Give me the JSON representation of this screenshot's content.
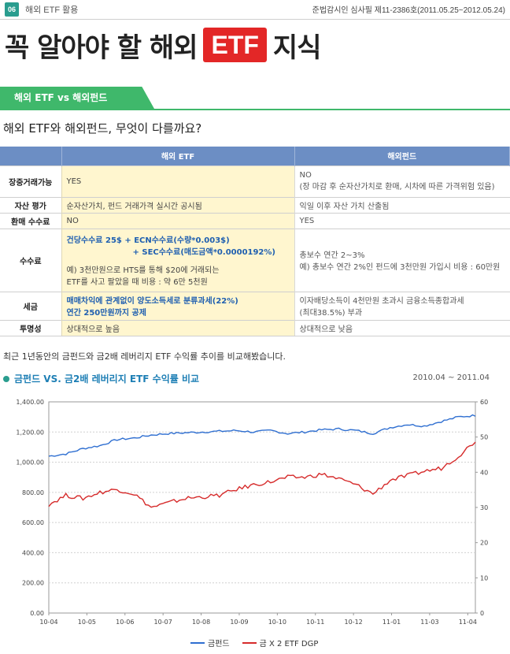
{
  "header": {
    "badge": "06",
    "section": "해외 ETF 활용",
    "review": "준법감시인 심사필 제11-2386호(2011.05.25~2012.05.24)"
  },
  "title": {
    "part1": "꼭 알아야 할 해외",
    "etf": "ETF",
    "part2": "지식"
  },
  "tab": {
    "label": "해외 ETF vs 해외펀드"
  },
  "question": "해외 ETF와 해외펀드, 무엇이 다를까요?",
  "table": {
    "headers": [
      "",
      "해외 ETF",
      "해외펀드"
    ],
    "rows": [
      {
        "label": "장중거래가능",
        "etf": [
          "YES"
        ],
        "fund": [
          "NO",
          "(장 마감 후 순자산가치로 환매, 시차에 따른 가격위험 있음)"
        ]
      },
      {
        "label": "자산 평가",
        "etf": [
          "순자산가치, 펀드 거래가격 실시간 공시됨"
        ],
        "fund": [
          "익일 이후 자산 가치 산출됨"
        ]
      },
      {
        "label": "환매 수수료",
        "etf": [
          "NO"
        ],
        "fund": [
          "YES"
        ]
      },
      {
        "label": "수수료",
        "etf_blue": [
          "건당수수료 25$ + ECN수수료(수량*0.003$)",
          "+ SEC수수료(매도금액*0.0000192%)"
        ],
        "etf": [
          "예) 3천만원으로 HTS를 통해 $20에 거래되는",
          "ETF를 사고 팔았을 때 비용 : 약 6만 5천원"
        ],
        "fund": [
          "총보수 연간 2~3%",
          "예) 총보수 연간 2%인 펀드에 3천만원 가입시 비용 : 60만원"
        ]
      },
      {
        "label": "세금",
        "etf_blue": [
          "매매차익에 관계없이 양도소득세로 분류과세(22%)",
          "연간 250만원까지 공제"
        ],
        "fund": [
          "이자배당소득이 4천만원 초과시 금융소득종합과세",
          "(최대38.5%) 부과"
        ]
      },
      {
        "label": "투명성",
        "etf": [
          "상대적으로 높음"
        ],
        "fund": [
          "상대적으로 낮음"
        ]
      }
    ]
  },
  "caption": "최근 1년동안의 금펀드와 금2배 레버리지 ETF 수익률 추이를 비교해봤습니다.",
  "chart_title": "금펀드 VS. 금2배 레버리지 ETF 수익률 비교",
  "chart_range": "2010.04 ~ 2011.04",
  "chart_data": {
    "type": "line",
    "x": [
      "10-04",
      "10-05",
      "10-06",
      "10-07",
      "10-08",
      "10-09",
      "10-10",
      "10-11",
      "10-12",
      "11-01",
      "11-03",
      "11-04"
    ],
    "left_axis": {
      "ticks": [
        "1,400.00",
        "1,200.00",
        "1,000.00",
        "800.00",
        "600.00",
        "400.00",
        "200.00",
        "0.00"
      ],
      "ylim": [
        0,
        1400
      ]
    },
    "right_axis": {
      "ticks": [
        "60",
        "50",
        "40",
        "30",
        "20",
        "10",
        "0"
      ],
      "ylim": [
        0,
        60
      ]
    },
    "grid": true,
    "legend_position": "bottom",
    "series": [
      {
        "name": "금펀드",
        "axis": "left",
        "color": "#2f6fd1",
        "values": [
          1040,
          1055,
          1090,
          1110,
          1150,
          1160,
          1180,
          1190,
          1195,
          1200,
          1205,
          1210,
          1200,
          1210,
          1190,
          1200,
          1215,
          1220,
          1210,
          1190,
          1230,
          1250,
          1240,
          1270,
          1300,
          1310
        ]
      },
      {
        "name": "금 X 2 ETF DGP",
        "axis": "left",
        "color": "#d62b2b",
        "values": [
          720,
          780,
          760,
          800,
          820,
          790,
          700,
          730,
          760,
          770,
          780,
          820,
          850,
          870,
          900,
          900,
          920,
          890,
          850,
          790,
          880,
          910,
          940,
          960,
          1040,
          1140
        ]
      }
    ]
  }
}
